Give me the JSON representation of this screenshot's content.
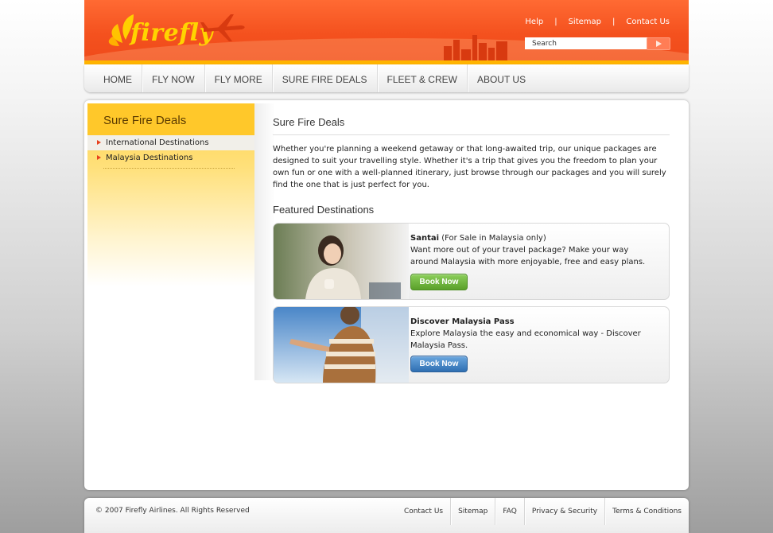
{
  "brand": {
    "name": "firefly",
    "accent": "#f4511e",
    "stripe": "#ffb400"
  },
  "toplinks": [
    "Help",
    "Sitemap",
    "Contact Us"
  ],
  "search": {
    "value": "Search"
  },
  "nav": [
    "HOME",
    "FLY NOW",
    "FLY MORE",
    "SURE FIRE DEALS",
    "FLEET & CREW",
    "ABOUT US"
  ],
  "sidebar": {
    "title": "Sure Fire Deals",
    "items": [
      "International Destinations",
      "Malaysia Destinations"
    ]
  },
  "content": {
    "title": "Sure Fire Deals",
    "intro": "Whether you're planning a weekend getaway or that long-awaited trip, our unique packages are designed to suit your travelling style. Whether it's a trip that gives you the freedom to plan your own fun or one with a well-planned itinerary, just browse through our packages and you will surely find the one that is just perfect for you.",
    "featured_title": "Featured Destinations",
    "cards": [
      {
        "title": "Santai",
        "note": " (For Sale in Malaysia only)",
        "desc": "Want more out of your travel package? Make your way around Malaysia with more enjoyable, free and easy plans.",
        "button": "Book Now",
        "button_color": "green"
      },
      {
        "title": "Discover Malaysia Pass",
        "note": "",
        "desc": "Explore Malaysia the easy and economical way - Discover Malaysia Pass.",
        "button": "Book Now",
        "button_color": "blue"
      }
    ]
  },
  "footer": {
    "copyright": "© 2007 Firefly Airlines. All Rights Reserved",
    "links": [
      "Contact Us",
      "Sitemap",
      "FAQ",
      "Privacy & Security",
      "Terms & Conditions"
    ]
  }
}
